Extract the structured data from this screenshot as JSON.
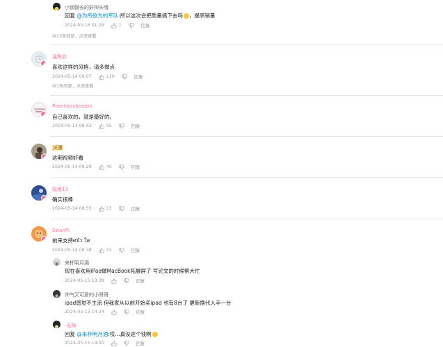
{
  "top_reply": {
    "username": "小钢钢长的好帅头哦",
    "reply_prefix": "回复",
    "mention": "@为所欲为的军队",
    "text": ":所以这次会把质量搞下去吗",
    "text_after": "，提高销量",
    "date": "2024-05-16 01:29",
    "likes": "1",
    "reply_label": "回复"
  },
  "top_summary": "共15条回复，点击查看",
  "comments": [
    {
      "username": "溪陈欣",
      "text": "喜欢这样的风格，请多做点",
      "date": "2024-05-14 09:07",
      "likes": "130",
      "reply_label": "回复",
      "summary": "共1条回复，点击查看"
    },
    {
      "username": "Poseidondondon",
      "text": "自己喜欢的，就是最好的。",
      "date": "2024-05-14 08:43",
      "likes": "55",
      "reply_label": "回复"
    },
    {
      "username": "沃重",
      "text": "这期视频好看",
      "date": "2024-05-14 09:29",
      "likes": "40",
      "reply_label": "回复"
    },
    {
      "username": "隐逸13",
      "text": "确实很棒",
      "date": "2024-05-14 08:55",
      "likes": "13",
      "reply_label": "回复"
    },
    {
      "username": "SwanPi",
      "text": "前来支持ศป๋ว ใค",
      "date": "2024-05-14 08:38",
      "likes": "13",
      "reply_label": "回复"
    }
  ],
  "sub_replies": [
    {
      "username": "来杯明月酒",
      "text": "现在喜欢用iPad做MacBook拓展屏了 写论文的时候帮大忙",
      "date": "2024-05-15 13:38",
      "likes": "",
      "reply_label": "回复"
    },
    {
      "username": "帅气又可爱的小哥哥",
      "text": "ipad感觉不主流 但我家从以前开始买ipad 也有8台了 更新换代入手一台",
      "date": "2024-05-15 14:34",
      "likes": "",
      "reply_label": "回复"
    },
    {
      "username": "-无局",
      "reply_prefix": "回复",
      "mention": "@来杯明月酒",
      "text": ":哎...真没这个钱啊",
      "date": "2024-05-15 19:00",
      "likes": "",
      "reply_label": "回复"
    }
  ],
  "colors": {
    "accent_pink": "#fb7299",
    "mention_blue": "#008ac5",
    "meta_gray": "#9499a0"
  },
  "icons": {
    "like": "thumbs-up-icon",
    "dislike": "thumbs-down-icon",
    "emoji": "smiley-emoji-icon"
  }
}
